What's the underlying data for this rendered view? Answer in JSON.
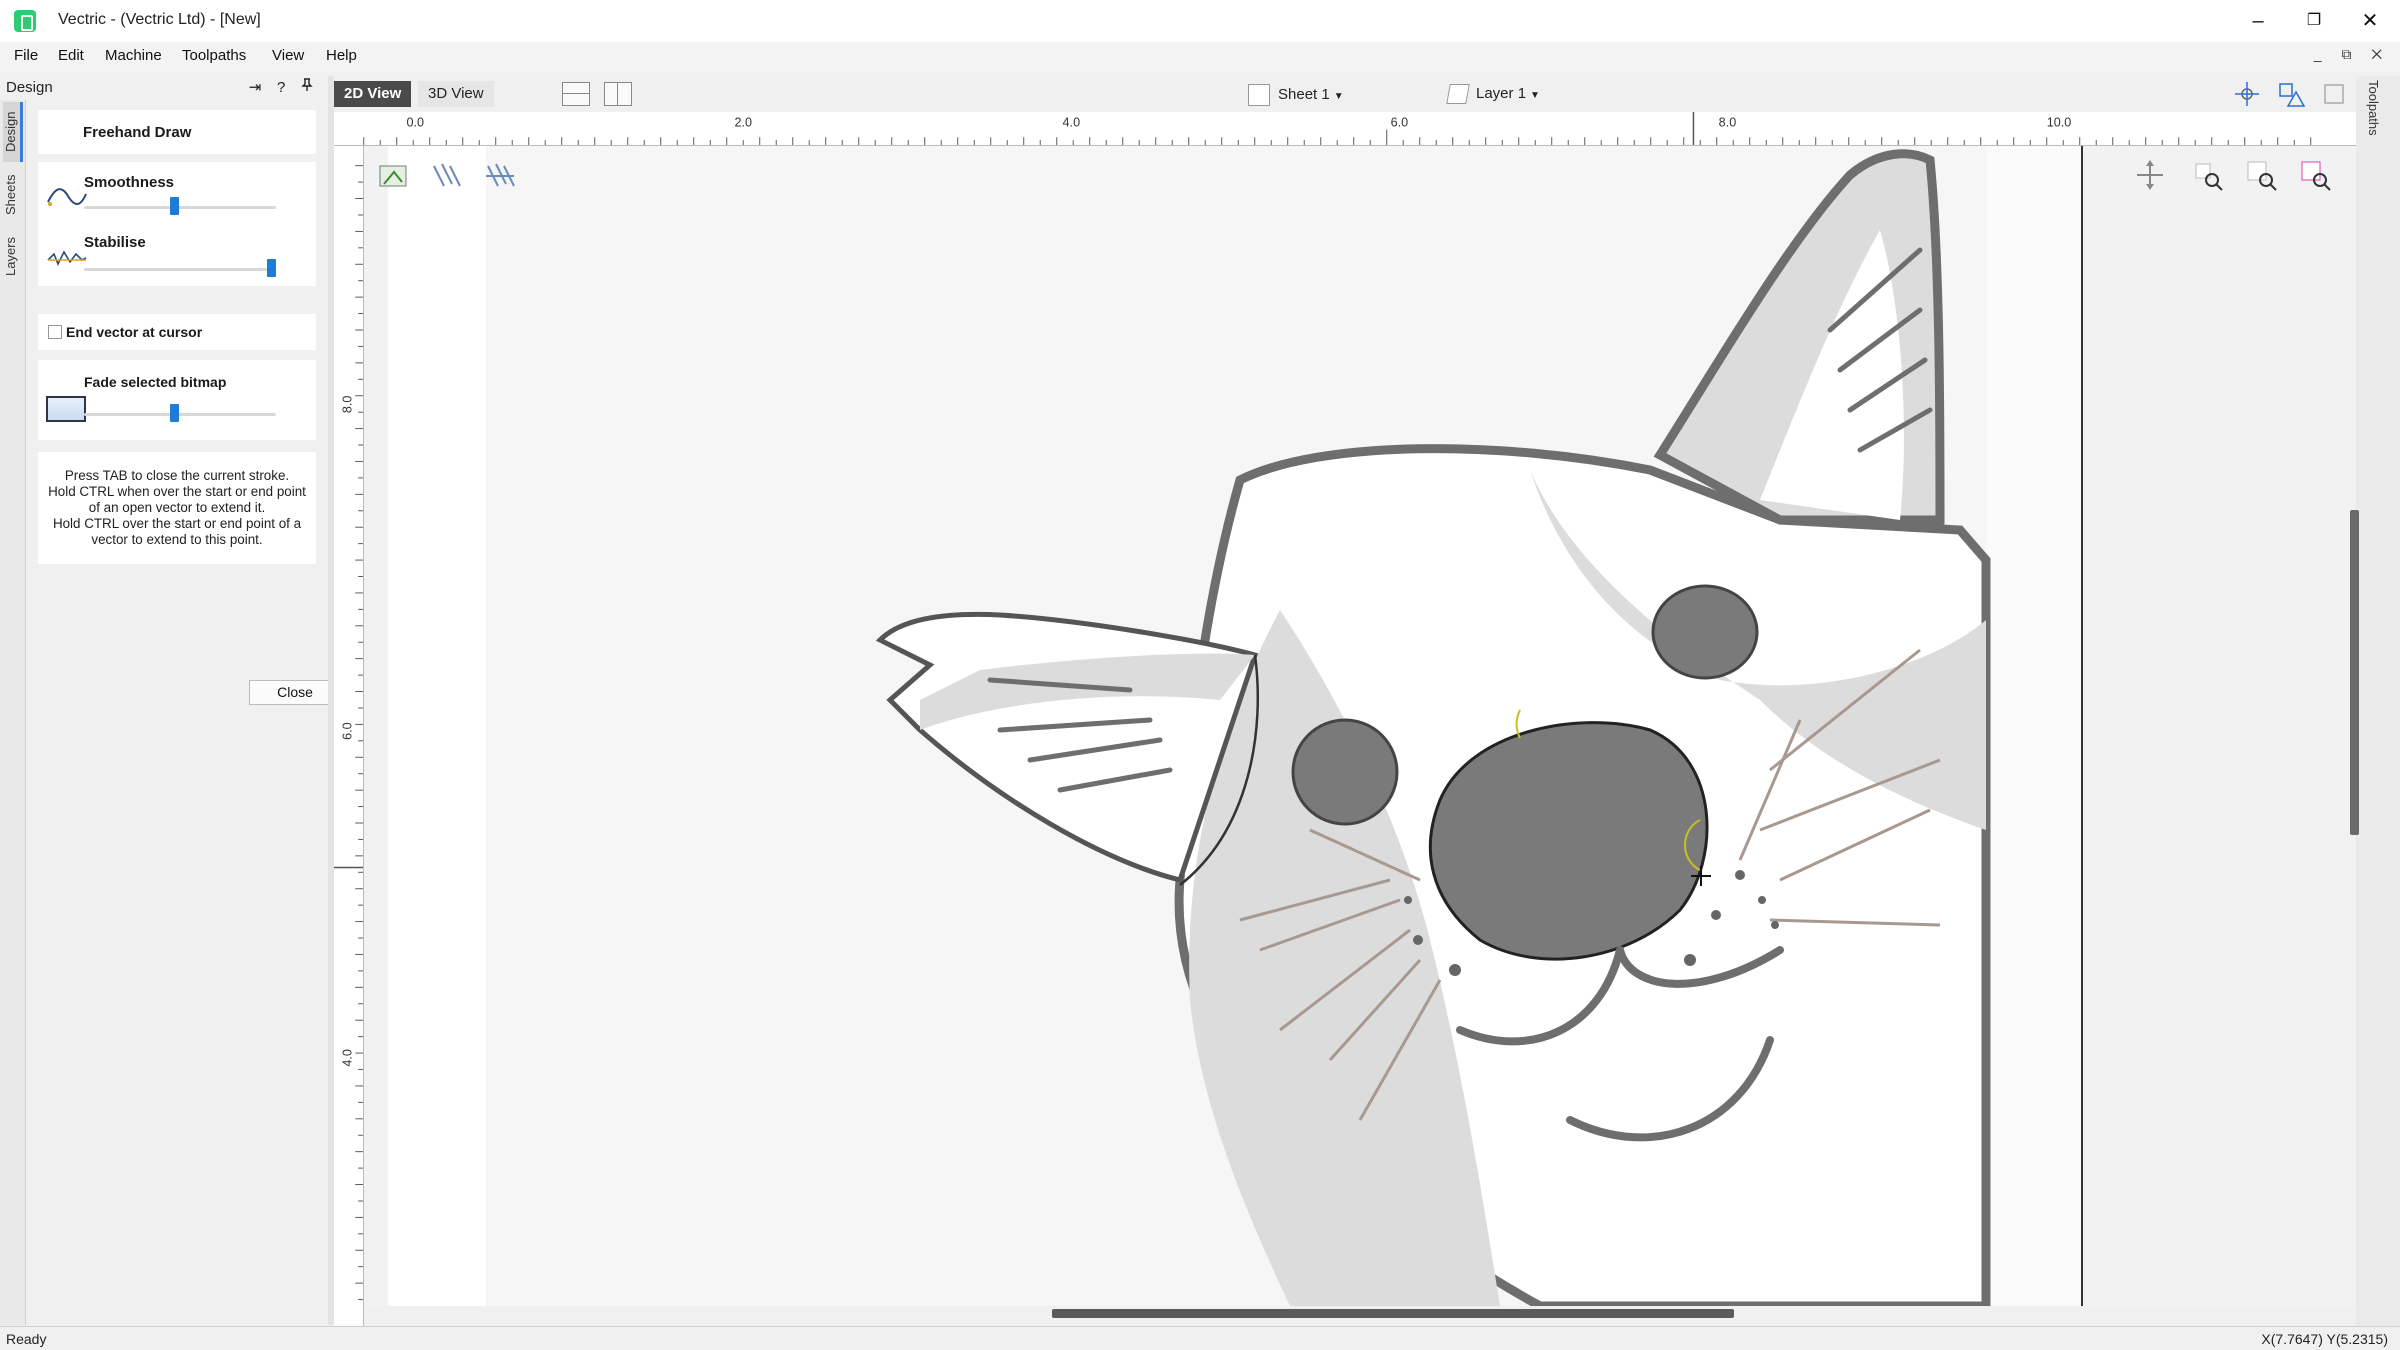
{
  "window": {
    "title": "Vectric - (Vectric Ltd) - [New]",
    "controls": [
      "–",
      "❐",
      "✕"
    ]
  },
  "menu": [
    "File",
    "Edit",
    "Machine",
    "Toolpaths",
    "View",
    "Help"
  ],
  "mdi_controls": "_ ⧉ ✕",
  "side_tabs": [
    "Design",
    "Sheets",
    "Layers"
  ],
  "panel": {
    "title": "Design",
    "header_icons": [
      "⇥",
      "?",
      "📌"
    ],
    "tool_title": "Freehand Draw",
    "smoothness": {
      "label": "Smoothness",
      "value": 0.47
    },
    "stabilise": {
      "label": "Stabilise",
      "value": 1.0
    },
    "end_vector_label": "End vector at cursor",
    "end_vector_checked": false,
    "fade": {
      "label": "Fade selected bitmap",
      "value": 0.47
    },
    "help_lines": [
      "Press TAB to close the current stroke.",
      "Hold CTRL when over the start or end point",
      "of an open vector to extend it.",
      "Hold CTRL over the start or end point of a",
      "vector to extend to this point."
    ],
    "close_label": "Close"
  },
  "view_toolbar": {
    "view_2d": "2D View",
    "view_3d": "3D View",
    "sheet": "Sheet 1",
    "layer": "Layer 1"
  },
  "ruler": {
    "h_labels": [
      "0.0",
      "2.0",
      "4.0",
      "6.0",
      "8.0",
      "10.0"
    ],
    "v_labels": [
      "8.0",
      "6.0",
      "4.0"
    ]
  },
  "right_tab": "Toolpaths",
  "status": {
    "text": "Ready",
    "coords": "X(7.7647) Y(5.2315)"
  },
  "colors": {
    "accent": "#1e7bd6",
    "outline": "#6e6e6e",
    "fur": "#d9d9d9",
    "nose": "#7a7a7a"
  }
}
